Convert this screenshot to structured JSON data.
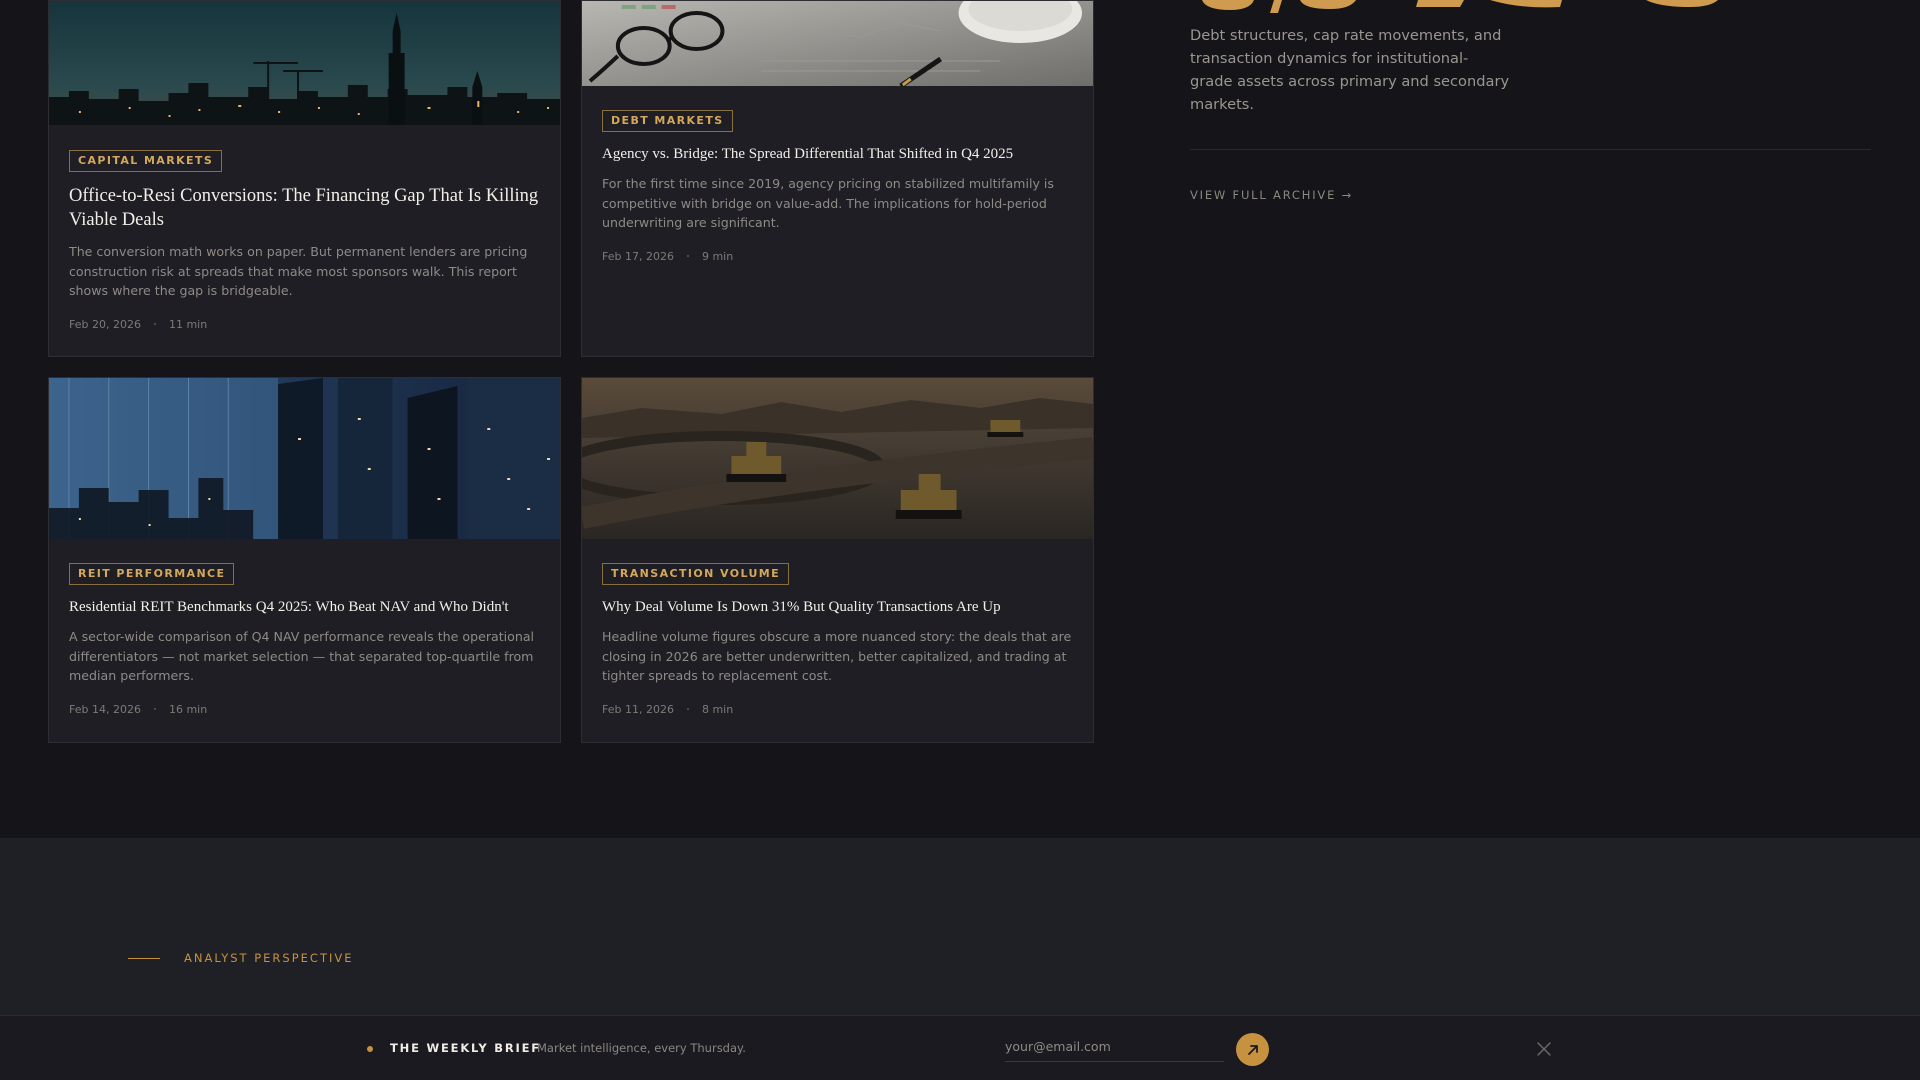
{
  "articles": [
    {
      "category": "CAPITAL MARKETS",
      "title": "Office-to-Resi Conversions: The Financing Gap That Is Killing Viable Deals",
      "description": "The conversion math works on paper. But permanent lenders are pricing construction risk at spreads that make most sponsors walk. This report shows where the gap is bridgeable.",
      "date": "Feb 20, 2026",
      "read_time": "11 min"
    },
    {
      "category": "DEBT MARKETS",
      "title": "Agency vs. Bridge: The Spread Differential That Shifted in Q4 2025",
      "description": "For the first time since 2019, agency pricing on stabilized multifamily is competitive with bridge on value-add. The implications for hold-period underwriting are significant.",
      "date": "Feb 17, 2026",
      "read_time": "9 min"
    },
    {
      "category": "REIT PERFORMANCE",
      "title": "Residential REIT Benchmarks Q4 2025: Who Beat NAV and Who Didn't",
      "description": "A sector-wide comparison of Q4 NAV performance reveals the operational differentiators — not market selection — that separated top-quartile from median performers.",
      "date": "Feb 14, 2026",
      "read_time": "16 min"
    },
    {
      "category": "TRANSACTION VOLUME",
      "title": "Why Deal Volume Is Down 31% But Quality Transactions Are Up",
      "description": "Headline volume figures obscure a more nuanced story: the deals that are closing in 2026 are better underwritten, better capitalized, and trading at tighter spreads to replacement cost.",
      "date": "Feb 11, 2026",
      "read_time": "8 min"
    }
  ],
  "hero": {
    "description": "Debt structures, cap rate movements, and transaction dynamics for institutional-grade assets across primary and secondary markets.",
    "archive_link": "VIEW FULL ARCHIVE →"
  },
  "perspective": {
    "label": "ANALYST PERSPECTIVE"
  },
  "newsletter": {
    "title": "THE WEEKLY BRIEF",
    "tagline": "Market intelligence, every Thursday.",
    "email_placeholder": "your@email.com"
  },
  "icons": {
    "submit": "arrow-up-right-icon",
    "close": "close-icon"
  },
  "colors": {
    "accent": "#c7923f",
    "background": "#151419",
    "card": "#1f1e25"
  }
}
